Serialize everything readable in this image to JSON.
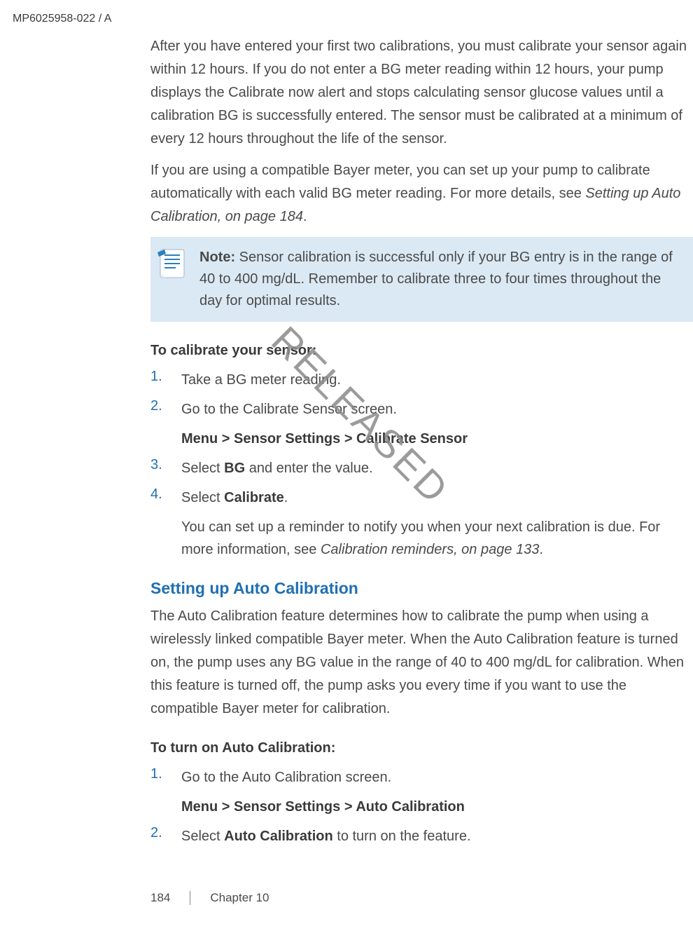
{
  "header": {
    "doc_code": "MP6025958-022 / A"
  },
  "paragraphs": {
    "p1": "After you have entered your first two calibrations, you must calibrate your sensor again within 12 hours. If you do not enter a BG meter reading within 12 hours, your pump displays the Calibrate now alert and stops calculating sensor glucose values until a calibration BG is successfully entered. The sensor must be calibrated at a minimum of every 12 hours throughout the life of the sensor.",
    "p2_a": "If you are using a compatible Bayer meter, you can set up your pump to calibrate automatically with each valid BG meter reading. For more details, see ",
    "p2_b_italic": "Setting up Auto Calibration, on page 184",
    "p2_c": "."
  },
  "note": {
    "label": "Note:",
    "text": "  Sensor calibration is successful only if your BG entry is in the range of 40 to 400 mg/dL. Remember to calibrate three to four times throughout the day for optimal results."
  },
  "cal_heading": "To calibrate your sensor:",
  "cal_steps": {
    "s1_num": "1.",
    "s1_text": "Take a BG meter reading.",
    "s2_num": "2.",
    "s2_text": "Go to the Calibrate Sensor screen.",
    "s2_menu": "Menu > Sensor Settings > Calibrate Sensor",
    "s3_num": "3.",
    "s3_a": "Select ",
    "s3_b": "BG",
    "s3_c": " and enter the value.",
    "s4_num": "4.",
    "s4_a": "Select ",
    "s4_b": "Calibrate",
    "s4_c": ".",
    "s4_sub_a": "You can set up a reminder to notify you when your next calibration is due. For more information, see ",
    "s4_sub_b_italic": "Calibration reminders, on page 133",
    "s4_sub_c": "."
  },
  "auto_heading": "Setting up Auto Calibration",
  "auto_para": "The Auto Calibration feature determines how to calibrate the pump when using a wirelessly linked compatible Bayer meter. When the Auto Calibration feature is turned on, the pump uses any BG value in the range of 40 to 400 mg/dL for calibration. When this feature is turned off, the pump asks you every time if you want to use the compatible Bayer meter for calibration.",
  "auto_turnon_heading": "To turn on Auto Calibration:",
  "auto_steps": {
    "s1_num": "1.",
    "s1_text": "Go to the Auto Calibration screen.",
    "s1_menu": "Menu > Sensor Settings > Auto Calibration",
    "s2_num": "2.",
    "s2_a": "Select ",
    "s2_b": "Auto Calibration",
    "s2_c": " to turn on the feature."
  },
  "watermark": "RELEASED",
  "footer": {
    "page": "184",
    "chapter": "Chapter 10"
  }
}
